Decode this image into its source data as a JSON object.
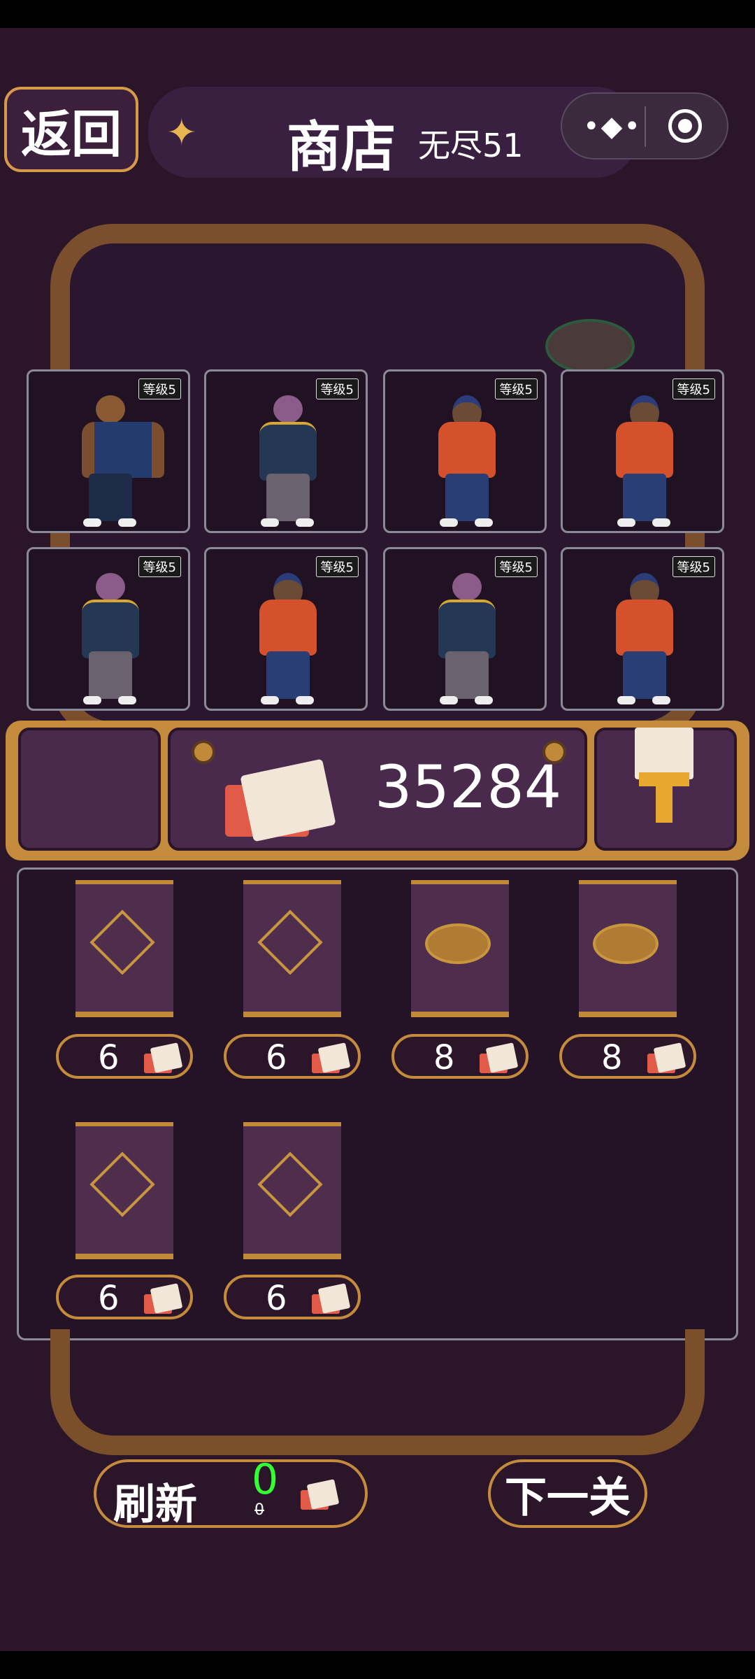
{
  "header": {
    "back_label": "返回",
    "title": "商店",
    "mode": "无尽51"
  },
  "units": [
    {
      "level": "等级5",
      "type": "eagle"
    },
    {
      "level": "等级5",
      "type": "hippo"
    },
    {
      "level": "等级5",
      "type": "monkey"
    },
    {
      "level": "等级5",
      "type": "monkey"
    },
    {
      "level": "等级5",
      "type": "hippo"
    },
    {
      "level": "等级5",
      "type": "monkey"
    },
    {
      "level": "等级5",
      "type": "hippo"
    },
    {
      "level": "等级5",
      "type": "monkey"
    }
  ],
  "resources": {
    "tickets": "35284"
  },
  "shop": {
    "items": [
      {
        "price": "6",
        "emblem": "diamond"
      },
      {
        "price": "6",
        "emblem": "diamond"
      },
      {
        "price": "8",
        "emblem": "oval"
      },
      {
        "price": "8",
        "emblem": "oval"
      },
      {
        "price": "6",
        "emblem": "diamond"
      },
      {
        "price": "6",
        "emblem": "diamond"
      }
    ]
  },
  "footer": {
    "refresh_label": "刷新",
    "refresh_cost": "0",
    "refresh_old_cost": "0",
    "next_label": "下一关"
  },
  "colors": {
    "accent": "#c58b3c",
    "background": "#2a1628",
    "free_cost": "#33ff33"
  }
}
